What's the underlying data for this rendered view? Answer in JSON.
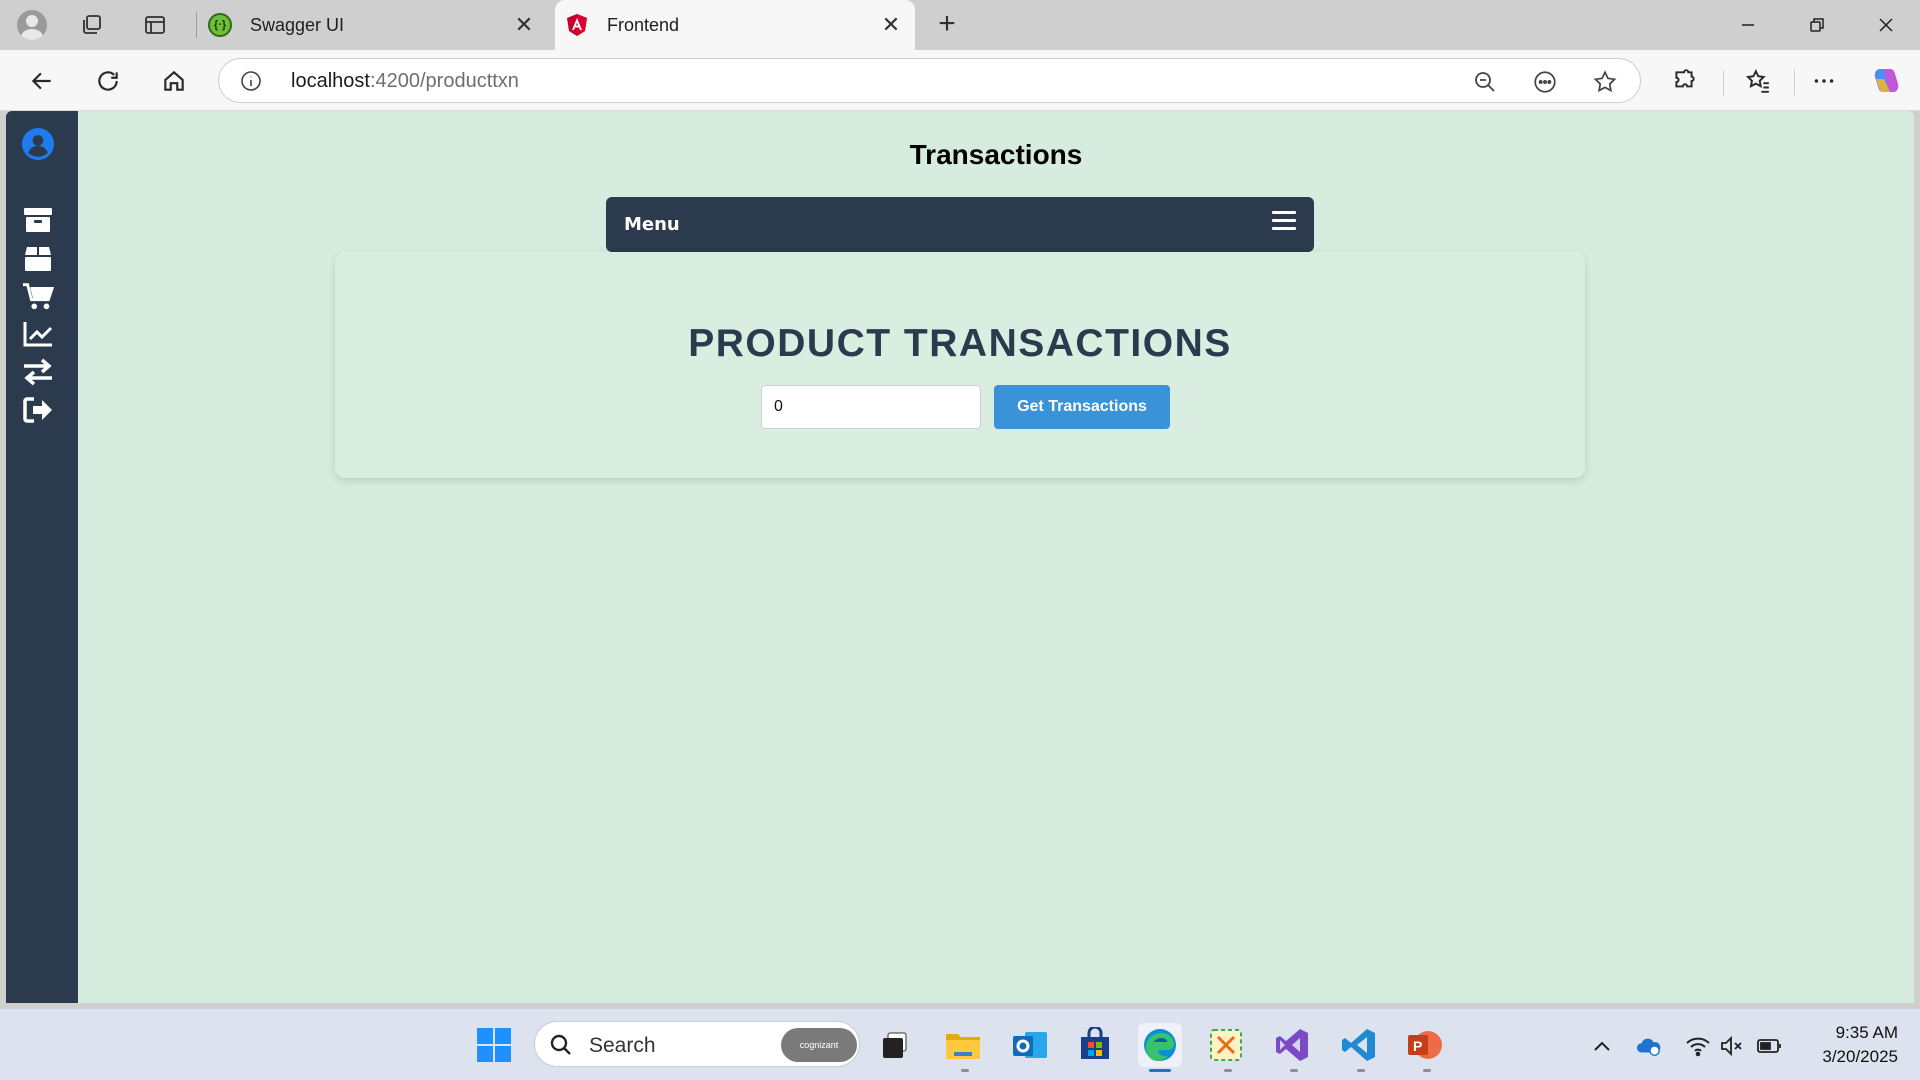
{
  "browser": {
    "tabs": [
      {
        "title": "Swagger UI",
        "favicon": "swagger-icon",
        "active": false
      },
      {
        "title": "Frontend",
        "favicon": "angular-icon",
        "active": true
      }
    ],
    "address": {
      "host": "localhost",
      "path": ":4200/producttxn"
    }
  },
  "app": {
    "page_title": "Transactions",
    "menu_label": "Menu",
    "sidebar_icons": [
      "user-circle-icon",
      "archive-icon",
      "box-icon",
      "cart-icon",
      "chart-line-icon",
      "exchange-icon",
      "logout-icon"
    ],
    "card": {
      "heading": "PRODUCT TRANSACTIONS",
      "input_value": "0",
      "button_label": "Get Transactions"
    },
    "colors": {
      "sidebar": "#2c3a4e",
      "page_bg": "#d5ecde",
      "button": "#3a93d8",
      "heading": "#2c3a4e"
    }
  },
  "taskbar": {
    "search_label": "Search",
    "search_badge": "cognizant",
    "time": "9:35 AM",
    "date": "3/20/2025"
  }
}
